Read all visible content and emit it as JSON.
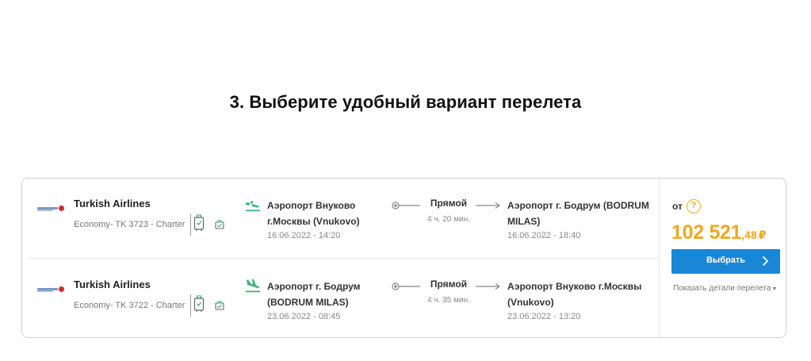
{
  "heading": "3. Выберите удобный вариант перелета",
  "legs": [
    {
      "airline": "Turkish Airlines",
      "class_info": "Economy- TK 3723 - Charter",
      "departure_airport": "Аэропорт Внуково г.Москвы (Vnukovo)",
      "departure_time": "16.06.2022 - 14:20",
      "route_type": "Прямой",
      "duration": "4 ч. 20 мин.",
      "arrival_airport": "Аэропорт г. Бодрум (BODRUM MILAS)",
      "arrival_time": "16.06.2022 - 18:40"
    },
    {
      "airline": "Turkish Airlines",
      "class_info": "Economy- TK 3722 - Charter",
      "departure_airport": "Аэропорт г. Бодрум (BODRUM MILAS)",
      "departure_time": "23.06.2022 - 08:45",
      "route_type": "Прямой",
      "duration": "4 ч. 35 мин.",
      "arrival_airport": "Аэропорт Внуково г.Москвы (Vnukovo)",
      "arrival_time": "23.06.2022 - 13:20"
    }
  ],
  "price": {
    "from_label": "от",
    "help_symbol": "?",
    "amount": "102 521",
    "cents": ",48",
    "currency": "₽"
  },
  "select_button": "Выбрать",
  "details_link": "Показать детали перелета",
  "colors": {
    "accent": "#f0a81c",
    "button": "#1a86d6",
    "plane": "#3cb37a"
  },
  "icons": {
    "departure": "plane-takeoff-icon",
    "arrival": "plane-landing-icon",
    "baggage": "suitcase-icon",
    "hand_luggage": "hand-luggage-icon"
  }
}
